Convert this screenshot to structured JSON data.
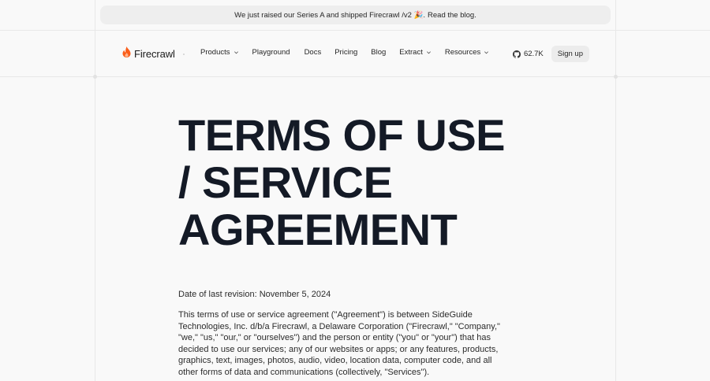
{
  "announcement": {
    "text": "We just raised our Series A and shipped Firecrawl /v2 🎉.",
    "link": "Read the blog."
  },
  "brand": {
    "name": "Firecrawl",
    "icon": "flame-icon",
    "accent": "#fa5d19"
  },
  "nav": {
    "items": [
      {
        "label": "Products",
        "dropdown": true
      },
      {
        "label": "Playground",
        "dropdown": false
      },
      {
        "label": "Docs",
        "dropdown": false
      },
      {
        "label": "Pricing",
        "dropdown": false
      },
      {
        "label": "Blog",
        "dropdown": false
      },
      {
        "label": "Extract",
        "dropdown": true
      },
      {
        "label": "Resources",
        "dropdown": true
      }
    ],
    "github_stars": "62.7K",
    "github_icon": "github-icon",
    "signup": "Sign up"
  },
  "page": {
    "title_lines": [
      "TERMS OF USE",
      "/ SERVICE",
      "AGREEMENT"
    ],
    "revision": "Date of last revision: November 5, 2024",
    "intro": "This terms of use or service agreement (\"Agreement\") is between SideGuide Technologies, Inc. d/b/a Firecrawl, a Delaware Corporation (\"Firecrawl,\" \"Company,\" \"we,\" \"us,\" \"our,\" or \"ourselves\") and the person or entity (\"you\" or \"your\") that has decided to use our services; any of our websites or apps; or any features, products, graphics, text, images, photos, audio, video, location data, computer code, and all other forms of data and communications (collectively, \"Services\")."
  }
}
